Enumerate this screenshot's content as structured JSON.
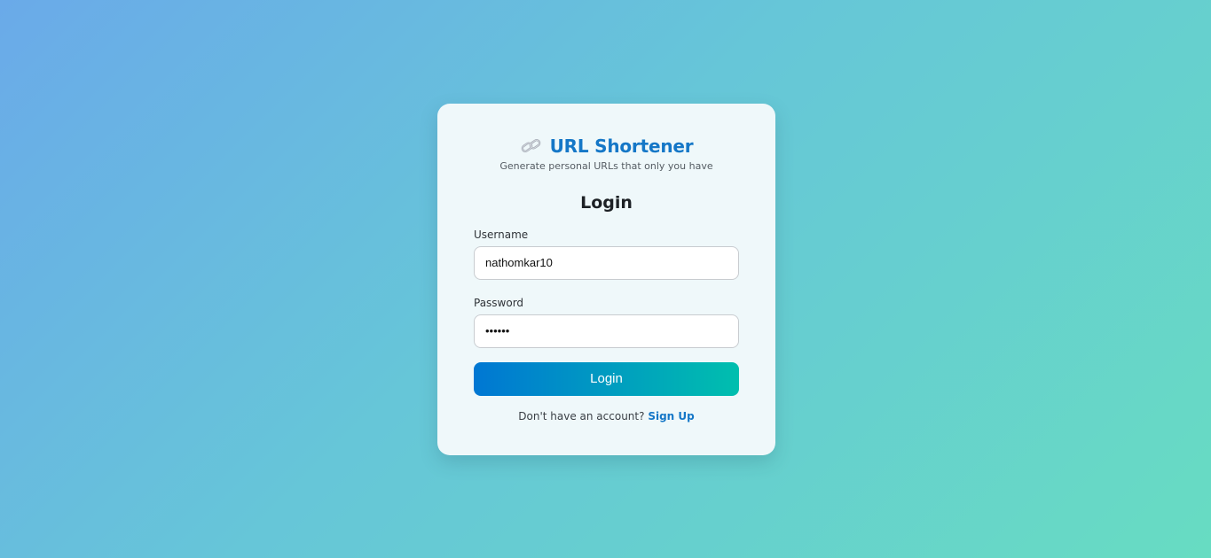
{
  "brand": {
    "icon": "link-icon",
    "title": "URL Shortener",
    "tagline": "Generate personal URLs that only you have"
  },
  "form": {
    "title": "Login",
    "username": {
      "label": "Username",
      "value": "nathomkar10"
    },
    "password": {
      "label": "Password",
      "masked_value": "••••••"
    },
    "submit_label": "Login",
    "signup_prompt": "Don't have an account?",
    "signup_link": "Sign Up"
  },
  "colors": {
    "accent": "#1577c7",
    "button_start": "#0077d3",
    "button_end": "#00bfae"
  }
}
